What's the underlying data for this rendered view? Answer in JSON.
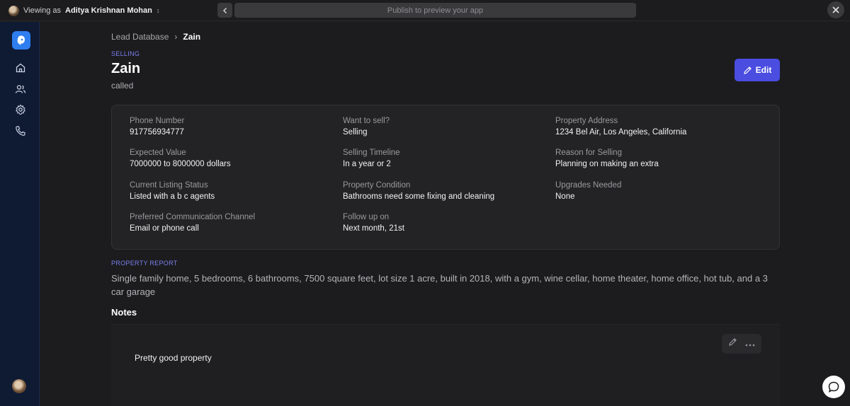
{
  "topbar": {
    "viewing_prefix": "Viewing as",
    "viewer_name": "Aditya Krishnan Mohan",
    "url_text": "Publish to preview your app"
  },
  "sidebar": {
    "items": [
      {
        "icon": "home-icon"
      },
      {
        "icon": "users-icon"
      },
      {
        "icon": "gear-icon"
      },
      {
        "icon": "phone-icon"
      }
    ]
  },
  "breadcrumb": {
    "parent": "Lead Database",
    "separator": "›",
    "current": "Zain"
  },
  "lead": {
    "status": "SELLING",
    "name": "Zain",
    "subtitle": "called"
  },
  "edit_label": "Edit",
  "fields": [
    {
      "label": "Phone Number",
      "value": "917756934777"
    },
    {
      "label": "Want to sell?",
      "value": "Selling"
    },
    {
      "label": "Property Address",
      "value": "1234 Bel Air, Los Angeles, California"
    },
    {
      "label": "Expected Value",
      "value": "7000000 to 8000000 dollars"
    },
    {
      "label": "Selling Timeline",
      "value": "In a year or 2"
    },
    {
      "label": "Reason for Selling",
      "value": "Planning on making an extra"
    },
    {
      "label": "Current Listing Status",
      "value": "Listed with a b c agents"
    },
    {
      "label": "Property Condition",
      "value": "Bathrooms need some fixing and cleaning"
    },
    {
      "label": "Upgrades Needed",
      "value": "None"
    },
    {
      "label": "Preferred Communication Channel",
      "value": "Email or phone call"
    },
    {
      "label": "Follow up on",
      "value": "Next month, 21st"
    }
  ],
  "report": {
    "label": "PROPERTY REPORT",
    "text": "Single family home, 5 bedrooms, 6 bathrooms, 7500 square feet, lot size 1 acre, built in 2018, with a gym, wine cellar, home theater, home office, hot tub, and a 3 car garage"
  },
  "notes": {
    "title": "Notes",
    "items": [
      {
        "text": "Pretty good property"
      }
    ]
  },
  "colors": {
    "accent": "#4a4de0",
    "label_accent": "#7b7ff0",
    "sidebar_bg": "#0f1a33",
    "logo_bg": "#2f7ef0"
  }
}
